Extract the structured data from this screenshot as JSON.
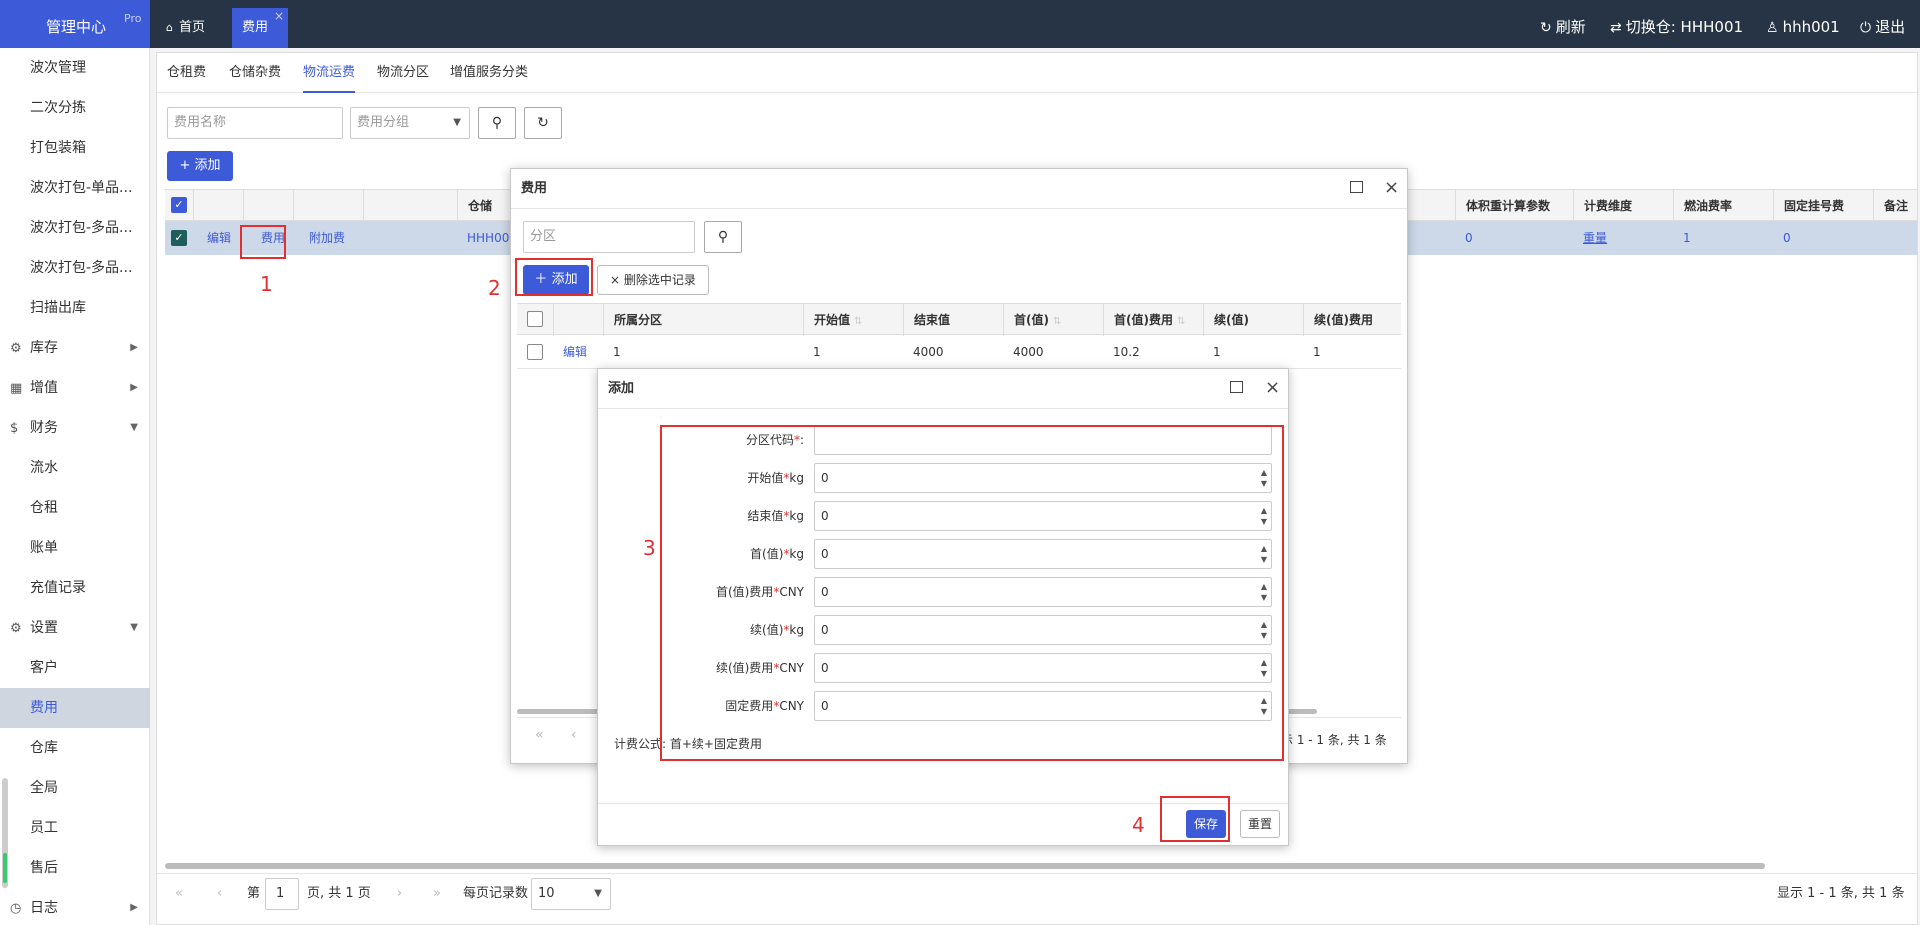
{
  "topbar": {
    "brand": "管理中心",
    "brand_badge": "Pro",
    "tab_home": "首页",
    "tab_active": "费用",
    "refresh": "刷新",
    "switch_warehouse": "切换仓: HHH001",
    "user": "hhh001",
    "logout": "退出"
  },
  "sidebar": {
    "items": [
      "波次管理",
      "二次分拣",
      "打包装箱",
      "波次打包-单品...",
      "波次打包-多品...",
      "波次打包-多品...",
      "扫描出库"
    ],
    "group_inventory": "库存",
    "group_value": "增值",
    "group_finance": "财务",
    "finance_items": [
      "流水",
      "仓租",
      "账单",
      "充值记录"
    ],
    "group_settings": "设置",
    "settings_items": [
      "客户",
      "费用",
      "仓库",
      "全局",
      "员工",
      "售后"
    ],
    "group_log": "日志"
  },
  "subtabs": [
    "仓租费",
    "仓储杂费",
    "物流运费",
    "物流分区",
    "增值服务分类"
  ],
  "search": {
    "name_placeholder": "费用名称",
    "group_placeholder": "费用分组"
  },
  "add_button": "+ 添加",
  "grid": {
    "headers": {
      "warehouse": "仓储",
      "volume": "体积重计算参数",
      "dimension": "计费维度",
      "fuel": "燃油费率",
      "fixed": "固定挂号费",
      "note": "备注"
    },
    "row": {
      "edit": "编辑",
      "fee": "费用",
      "surcharge": "附加费",
      "warehouse": "HHH001",
      "volume": "0",
      "dimension": "重量",
      "fuel": "1",
      "fixed": "0"
    }
  },
  "pager": {
    "page_prefix": "第",
    "page": "1",
    "page_suffix": "页, 共 1 页",
    "per_page_label": "每页记录数",
    "per_page": "10",
    "summary": "显示 1 - 1 条, 共 1 条"
  },
  "dialog_fee": {
    "title": "费用",
    "zone_placeholder": "分区",
    "add": "添加",
    "delete_selected": "删除选中记录",
    "headers": [
      "所属分区",
      "开始值",
      "结束值",
      "首(值)",
      "首(值)费用",
      "续(值)",
      "续(值)费用"
    ],
    "row": {
      "edit": "编辑",
      "zone": "1",
      "start": "1",
      "end": "4000",
      "first": "4000",
      "first_fee": "10.2",
      "next": "1",
      "next_fee": "1"
    },
    "summary": "示 1 - 1 条, 共 1 条"
  },
  "dialog_add": {
    "title": "添加",
    "fields": [
      {
        "label": "分区代码",
        "unit": ":",
        "value": ""
      },
      {
        "label": "开始值",
        "unit": "kg",
        "value": "0"
      },
      {
        "label": "结束值",
        "unit": "kg",
        "value": "0"
      },
      {
        "label": "首(值)",
        "unit": "kg",
        "value": "0"
      },
      {
        "label": "首(值)费用",
        "unit": "CNY",
        "value": "0"
      },
      {
        "label": "续(值)",
        "unit": "kg",
        "value": "0"
      },
      {
        "label": "续(值)费用",
        "unit": "CNY",
        "value": "0"
      },
      {
        "label": "固定费用",
        "unit": "CNY",
        "value": "0"
      }
    ],
    "formula": "计费公式: 首+续+固定费用",
    "save": "保存",
    "reset": "重置"
  },
  "annotations": [
    "1",
    "2",
    "3",
    "4"
  ],
  "colors": {
    "topbar": "#263445",
    "primary": "#3d5bd8",
    "annotation": "#e03030"
  }
}
